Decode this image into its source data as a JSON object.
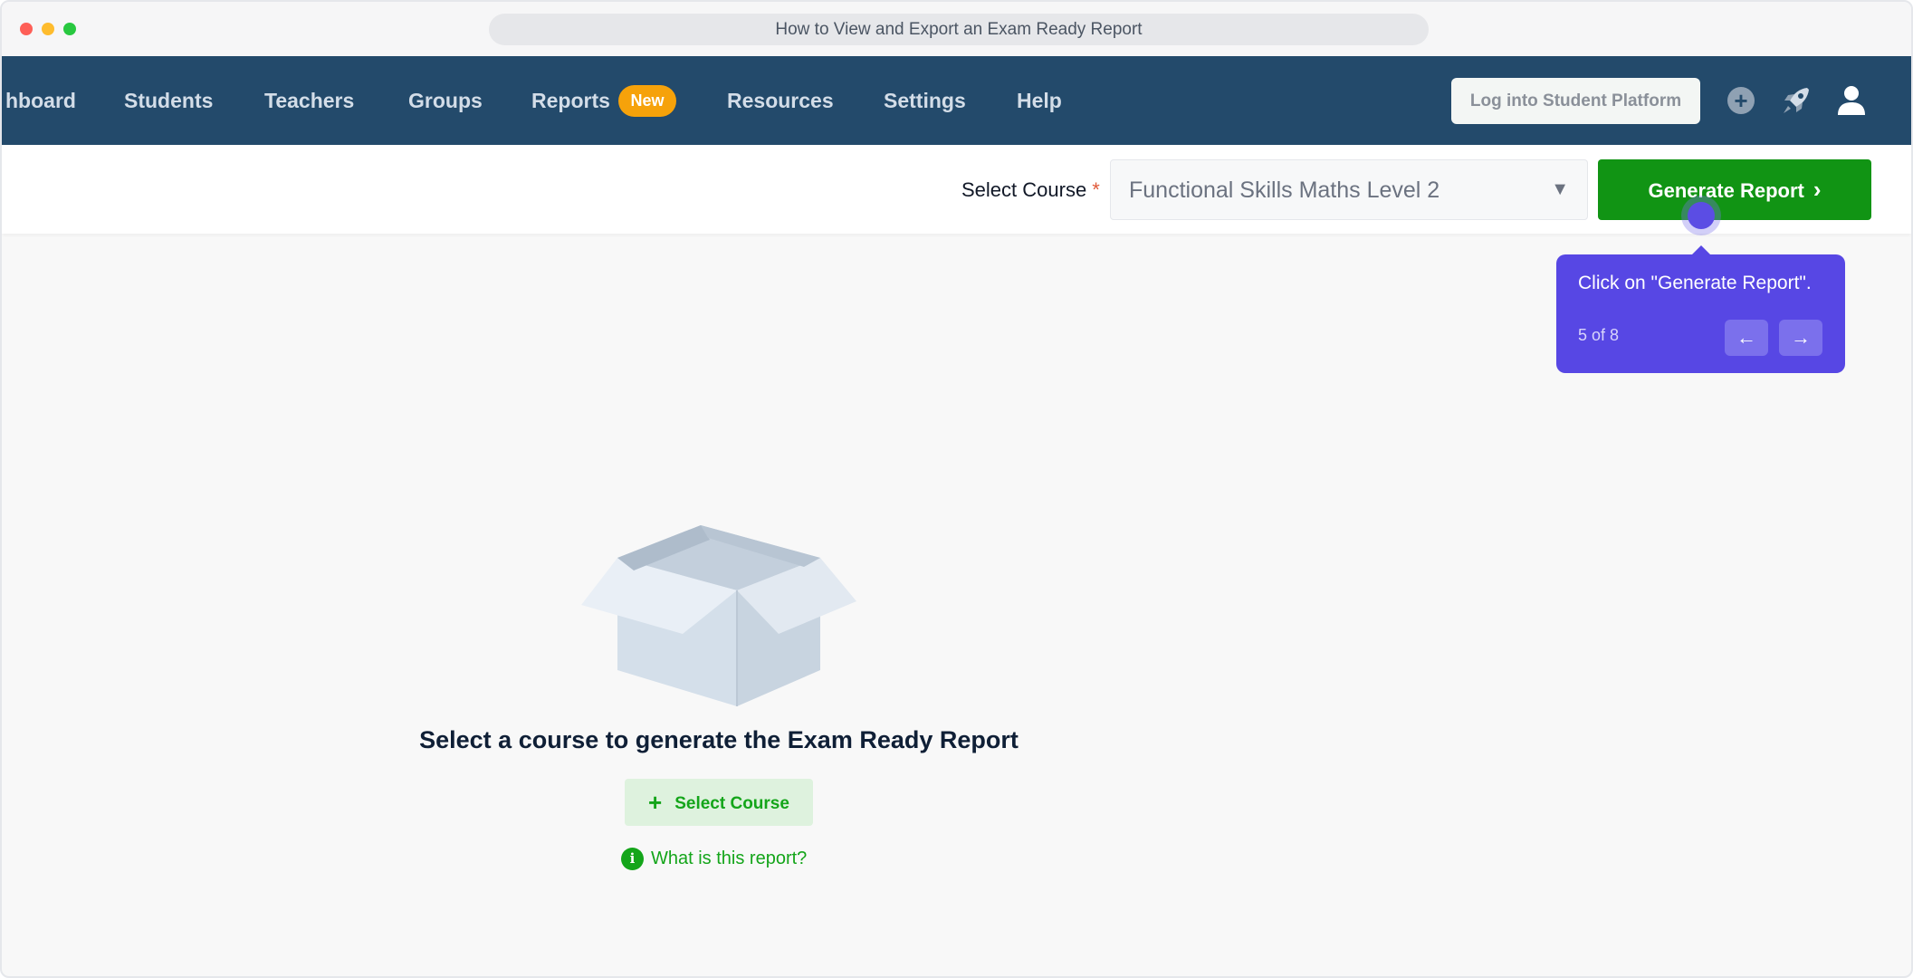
{
  "browser": {
    "title": "How to View and Export an Exam Ready Report"
  },
  "nav": {
    "items": [
      {
        "label": "hboard"
      },
      {
        "label": "Students"
      },
      {
        "label": "Teachers"
      },
      {
        "label": "Groups"
      },
      {
        "label": "Reports"
      },
      {
        "label": "Resources"
      },
      {
        "label": "Settings"
      },
      {
        "label": "Help"
      }
    ],
    "reports_badge": "New",
    "login_button": "Log into Student Platform",
    "add_icon": "+"
  },
  "toolbar": {
    "select_label": "Select Course",
    "required_marker": "*",
    "course_value": "Functional Skills Maths Level 2",
    "caret": "▼",
    "generate_button": "Generate Report",
    "generate_chevron": "›"
  },
  "tooltip": {
    "text": "Click on \"Generate Report\".",
    "step": "5 of 8",
    "prev": "←",
    "next": "→"
  },
  "empty_state": {
    "title": "Select a course to generate the Exam Ready Report",
    "button_icon": "+",
    "button_label": "Select Course",
    "info_icon": "i",
    "info_link": "What is this report?"
  },
  "colors": {
    "nav_bg": "#234a6b",
    "primary_green": "#119414",
    "tooltip_purple": "#5747e4",
    "badge_orange": "#f6a20a"
  }
}
